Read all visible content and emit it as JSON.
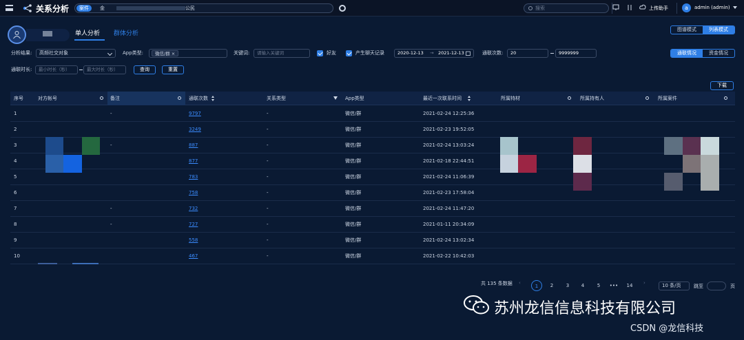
{
  "topbar": {
    "title": "关系分析",
    "case_tag": "案件",
    "case_name": "金",
    "case_suffix": "公民",
    "search_placeholder": "搜索",
    "upload_label": "上传助手",
    "avatar_letter": "a",
    "user_label": "admin (admin)"
  },
  "tabs": {
    "single": "单人分析",
    "group": "群体分析"
  },
  "modes": {
    "graph": "图谱模式",
    "list": "列表模式"
  },
  "filters": {
    "analysis_label": "分析结果:",
    "analysis_value": "高频社交对象",
    "app_label": "App类型:",
    "app_chip": "微信/群",
    "keyword_label": "关键词:",
    "keyword_placeholder": "请输入关键词",
    "friend_label": "好友",
    "chat_label": "产生聊天记录",
    "date_start": "2020-12-13",
    "date_arrow": "→",
    "date_end": "2021-12-13",
    "count_label": "通联次数:",
    "count_min": "20",
    "count_max": "9999999",
    "duration_label": "通联时长:",
    "dur_min_placeholder": "最小时长（秒）",
    "dur_max_placeholder": "最大时长（秒）",
    "query_button": "查询",
    "reset_button": "重置",
    "contact_tab": "通联情况",
    "fund_tab": "资金情况",
    "download_button": "下载"
  },
  "table": {
    "headers": [
      "序号",
      "对方帐号",
      "备注",
      "通联次数",
      "关系类型",
      "App类型",
      "最近一次联系时间",
      "所属特材",
      "所属持有人",
      "所属案件"
    ],
    "rows": [
      {
        "no": "1",
        "note": "-",
        "count": "9797",
        "rel": "-",
        "app": "微信/群",
        "time": "2021-02-24 12:25:36"
      },
      {
        "no": "2",
        "note": "",
        "count": "3249",
        "rel": "-",
        "app": "微信/群",
        "time": "2021-02-23 19:52:05"
      },
      {
        "no": "3",
        "note": "-",
        "count": "887",
        "rel": "-",
        "app": "微信/群",
        "time": "2021-02-24 13:03:24"
      },
      {
        "no": "4",
        "note": "",
        "count": "877",
        "rel": "-",
        "app": "微信/群",
        "time": "2021-02-18 22:44:51"
      },
      {
        "no": "5",
        "note": "",
        "count": "783",
        "rel": "-",
        "app": "微信/群",
        "time": "2021-02-24 11:06:39"
      },
      {
        "no": "6",
        "note": "",
        "count": "758",
        "rel": "-",
        "app": "微信/群",
        "time": "2021-02-23 17:58:04"
      },
      {
        "no": "7",
        "note": "-",
        "count": "732",
        "rel": "-",
        "app": "微信/群",
        "time": "2021-02-24 11:47:20"
      },
      {
        "no": "8",
        "note": "-",
        "count": "727",
        "rel": "-",
        "app": "微信/群",
        "time": "2021-01-11 20:34:09"
      },
      {
        "no": "9",
        "note": "",
        "count": "558",
        "rel": "-",
        "app": "微信/群",
        "time": "2021-02-24 13:02:34"
      },
      {
        "no": "10",
        "note": "",
        "count": "467",
        "rel": "-",
        "app": "微信/群",
        "time": "2021-02-22 10:42:03"
      }
    ]
  },
  "pager": {
    "total": "共 135 条数据",
    "pages": [
      "1",
      "2",
      "3",
      "4",
      "5",
      "•••",
      "14"
    ],
    "per_page": "10 条/页",
    "jump_label": "跳至",
    "page_unit": "页"
  },
  "watermark": {
    "company": "苏州龙信信息科技有限公司",
    "csdn": "CSDN @龙信科技"
  }
}
